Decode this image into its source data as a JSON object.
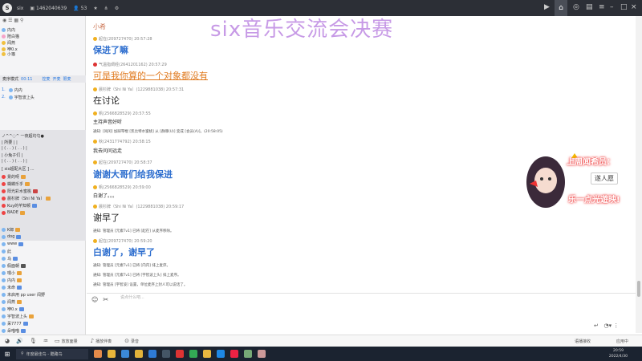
{
  "topbar": {
    "app_name": "six",
    "id_value": "1462040639",
    "count": "53"
  },
  "left_panel": {
    "tabs": [],
    "members_top": [
      "内内",
      "陪白猫",
      "闻燕",
      "咿0.x",
      "小猫"
    ],
    "mode_label": "麦序模式",
    "mode_time": "00:11",
    "mode_links": [
      "控麦",
      "开麦",
      "限麦"
    ],
    "queue": [
      {
        "num": "1.",
        "name": "内内"
      },
      {
        "num": "2.",
        "name": "宇智波上头"
      }
    ],
    "chat_art": [
      "ノ^^◌^ 一夜超均匀●",
      "|       所要      |  |",
      "|   ( . . )   ( . . )  |",
      "|       小兔子们      |",
      "|  ( . . )   ( . . )   |",
      "[ six超配大区 ] …"
    ],
    "members_mid": [
      "景的呀",
      "蝴蝶乐乎",
      "阳光彩水蜜桃",
      "晨杉牌（Shi Ni Ya）",
      "Kuy的芊知顿",
      "BADE"
    ],
    "members_bottom": [
      "K郎",
      "dog",
      "www",
      "此",
      "乌",
      "假面朝",
      "嘿小",
      "内内",
      "未命",
      "未启用 pp user 闻野",
      "闻燕",
      "咿0.x",
      "宇智波上头",
      "呆7777",
      "朵喵喵",
      "小期"
    ]
  },
  "watermark": "six音乐交流会决赛",
  "chat": {
    "top_name": "小希",
    "messages": [
      {
        "meta": "起在(209727470)  20:57:28",
        "text": "保进了嘛",
        "style": "big-blue"
      },
      {
        "meta": "气温指绸经(2641201162)  20:57:29",
        "text": "可是我你算的一个对象都没有",
        "style": "orange"
      },
      {
        "meta": "晨杉牌（Shi Ni Ya）(1229881038)  20:57:31",
        "text": "在讨论",
        "style": "big-dark"
      },
      {
        "meta": "帆(2566828529)  20:57:55",
        "text": "主持声音好听",
        "style": "small"
      },
      {
        "sys": "通知: [闲闲] 加踩琴棍 [凯比特水蜜桃] 从 [群哪(U)] 变成 [会员(A)]。(20:58:05)"
      },
      {
        "meta": "秋(2431774792)  20:58:15",
        "text": "我去问问远走",
        "style": "small"
      },
      {
        "meta": "起在(209727470)  20:58:37",
        "text": "谢谢大哥们给我保进",
        "style": "big-blue"
      },
      {
        "meta": "帆(2566828529)  20:59:00",
        "text": "白谢了。。。",
        "style": "small"
      },
      {
        "meta": "晨杉牌（Shi Ni Ya）(1229881038)  20:59:17",
        "text": "谢早了",
        "style": "big-dark"
      },
      {
        "sys": "通知: 管理员 [元素Tv1] 已将 [起在] 从麦序移除。"
      },
      {
        "meta": "起在(209727470)  20:59:20",
        "text": "白谢了，谢早了",
        "style": "big-blue"
      },
      {
        "sys": "通知: 管理员 [元素Tv1] 已将 [内内] 排上麦序。"
      },
      {
        "sys": "通知: 管理员 [元素Tv1] 已将 [宇智波上头] 排上麦序。"
      },
      {
        "sys": "通知: 管理员 [宇智波] 设置，单位麦序上封人可以说话了。"
      }
    ]
  },
  "input": {
    "placeholder": "说点什么吧..."
  },
  "overlay": {
    "line1": "上周闻希员：",
    "name": "遂人愿",
    "line2": "乐一点光遊映!"
  },
  "bottom_bar": [
    "放放面量",
    "播放伴奏",
    "录音"
  ],
  "taskbar": {
    "search": "年度最佳鸟 - 酷路鸟",
    "time": "20:59",
    "date": "2022/4/30",
    "tray_a": "语播接收",
    "tray_b": "应用中"
  }
}
